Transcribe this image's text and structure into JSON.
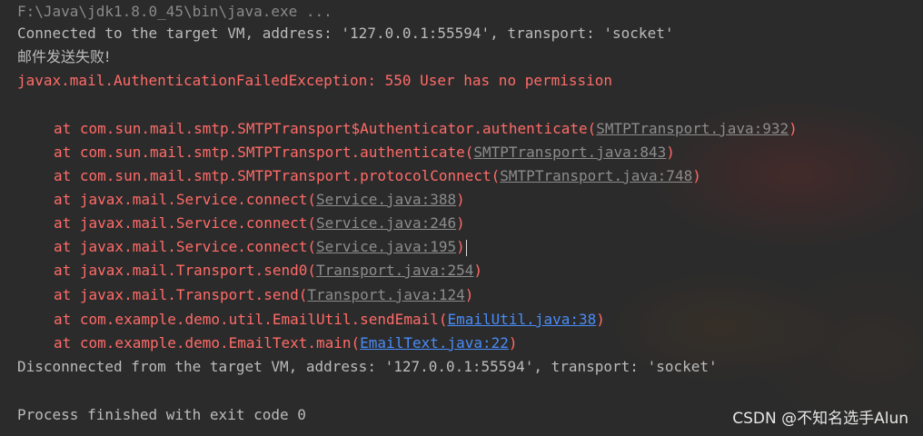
{
  "console": {
    "command_line": "F:\\Java\\jdk1.8.0_45\\bin\\java.exe ...",
    "connected": "Connected to the target VM, address: '127.0.0.1:55594', transport: 'socket'",
    "mail_failed": "邮件发送失败!",
    "exception": "javax.mail.AuthenticationFailedException: 550 User has no permission",
    "stack": [
      {
        "prefix": "at com.sun.mail.smtp.SMTPTransport$Authenticator.authenticate(",
        "link": "SMTPTransport.java:932",
        "suffix": ")",
        "kind": "library"
      },
      {
        "prefix": "at com.sun.mail.smtp.SMTPTransport.authenticate(",
        "link": "SMTPTransport.java:843",
        "suffix": ")",
        "kind": "library"
      },
      {
        "prefix": "at com.sun.mail.smtp.SMTPTransport.protocolConnect(",
        "link": "SMTPTransport.java:748",
        "suffix": ")",
        "kind": "library"
      },
      {
        "prefix": "at javax.mail.Service.connect(",
        "link": "Service.java:388",
        "suffix": ")",
        "kind": "library"
      },
      {
        "prefix": "at javax.mail.Service.connect(",
        "link": "Service.java:246",
        "suffix": ")",
        "kind": "library"
      },
      {
        "prefix": "at javax.mail.Service.connect(",
        "link": "Service.java:195",
        "suffix": ")",
        "kind": "library"
      },
      {
        "prefix": "at javax.mail.Transport.send0(",
        "link": "Transport.java:254",
        "suffix": ")",
        "kind": "library"
      },
      {
        "prefix": "at javax.mail.Transport.send(",
        "link": "Transport.java:124",
        "suffix": ")",
        "kind": "library"
      },
      {
        "prefix": "at com.example.demo.util.EmailUtil.sendEmail(",
        "link": "EmailUtil.java:38",
        "suffix": ")",
        "kind": "project"
      },
      {
        "prefix": "at com.example.demo.EmailText.main(",
        "link": "EmailText.java:22",
        "suffix": ")",
        "kind": "project"
      }
    ],
    "disconnected": "Disconnected from the target VM, address: '127.0.0.1:55594', transport: 'socket'",
    "process_finished": "Process finished with exit code 0"
  },
  "watermark": "CSDN @不知名选手Alun",
  "colors": {
    "background": "#2b2b2b",
    "plain_text": "#bbbbbb",
    "error_text": "#ff6b68",
    "library_link": "#8c8c8c",
    "project_link": "#4a8cf7"
  }
}
